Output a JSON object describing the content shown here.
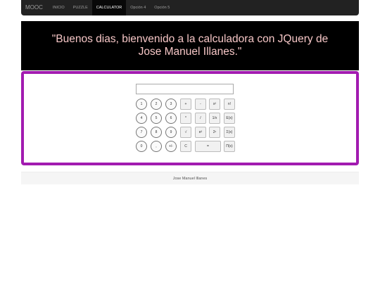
{
  "nav": {
    "brand": "MOOC",
    "items": [
      {
        "label": "INICIO"
      },
      {
        "label": "PUZZLE"
      },
      {
        "label": "CALCULATOR"
      },
      {
        "label": "Opción 4"
      },
      {
        "label": "Opción 5"
      }
    ],
    "active": "CALCULATOR"
  },
  "banner": {
    "text": "\"Buenos dias, bienvenido a la calculadora con JQuery de Jose Manuel Illanes.\""
  },
  "calculator": {
    "display_value": "",
    "rows": [
      [
        "1",
        "2",
        "3",
        "+",
        "-",
        "x²",
        "n!"
      ],
      [
        "4",
        "5",
        "6",
        "*",
        "/",
        "1/x",
        "E(x)"
      ],
      [
        "7",
        "8",
        "9",
        "√",
        "e²",
        "2ˣ",
        "Σ(x)"
      ],
      [
        "0",
        ",",
        "+/-",
        "C",
        "=",
        "Π(x)"
      ]
    ]
  },
  "footer": {
    "text": "Jose Manuel Illanes"
  },
  "colors": {
    "navbar": "#222222",
    "banner_bg": "#000000",
    "banner_text": "#f6c6c6",
    "panel_border": "#a21bb0"
  }
}
